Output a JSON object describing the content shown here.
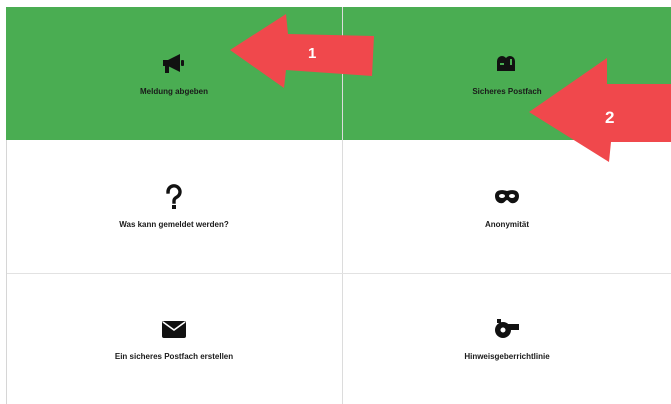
{
  "tiles": [
    {
      "label": "Meldung abgeben",
      "icon": "megaphone-icon"
    },
    {
      "label": "Sicheres Postfach",
      "icon": "mailbox-icon"
    },
    {
      "label": "Was kann gemeldet werden?",
      "icon": "question-mark-icon"
    },
    {
      "label": "Anonymität",
      "icon": "mask-icon"
    },
    {
      "label": "Ein sicheres Postfach erstellen",
      "icon": "envelope-icon"
    },
    {
      "label": "Hinweisgeberrichtlinie",
      "icon": "whistle-icon"
    }
  ],
  "annotations": {
    "arrow_1": "1",
    "arrow_2": "2"
  },
  "colors": {
    "highlight_tile": "#4aad52",
    "arrow": "#f0484c"
  }
}
